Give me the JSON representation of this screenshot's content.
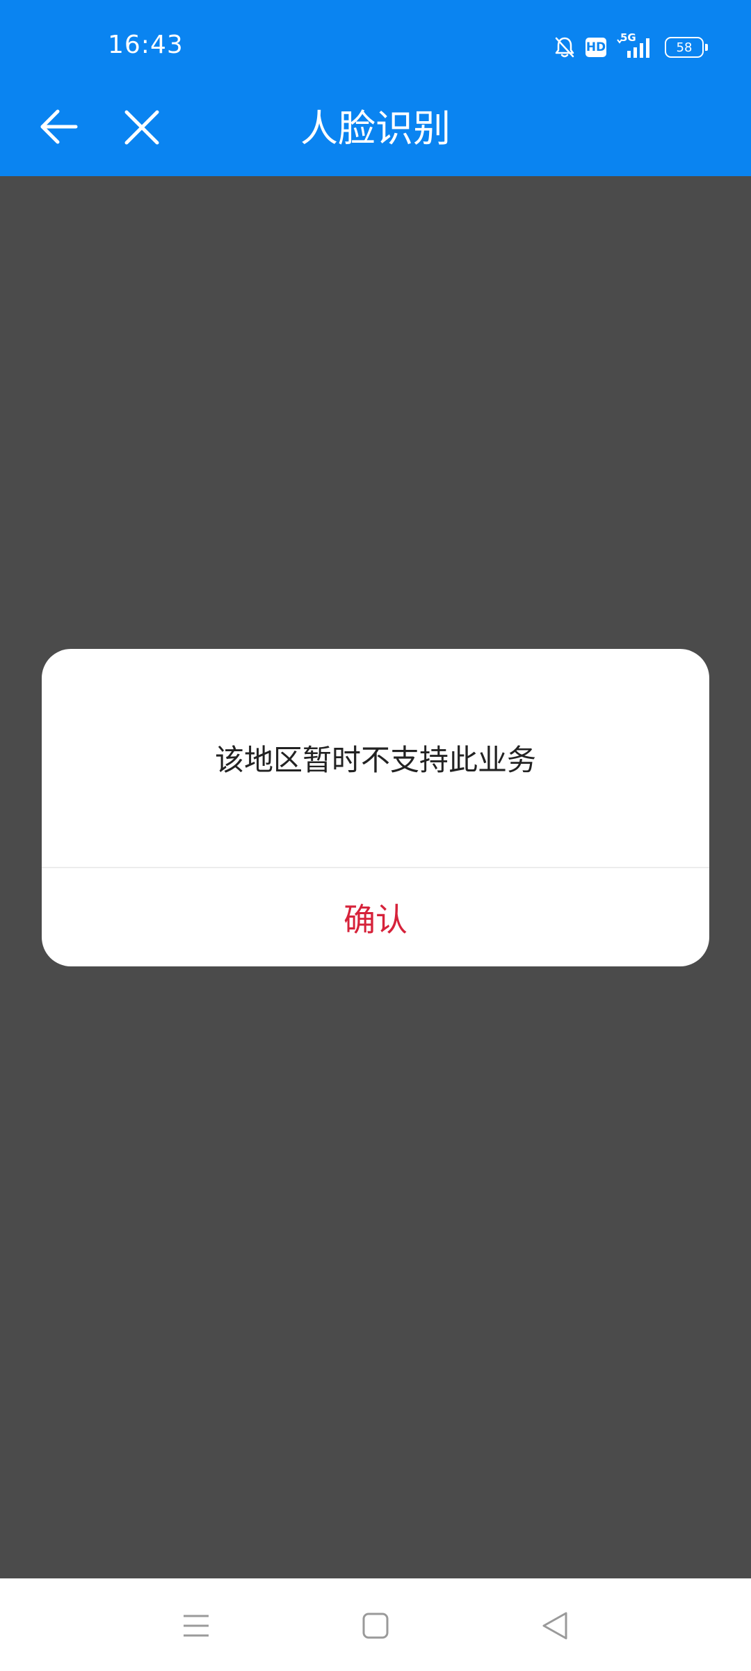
{
  "status_bar": {
    "time": "16:43",
    "hd_label": "HD",
    "network_label": "5G",
    "battery_level": "58",
    "icons": [
      "bell-off-icon",
      "hd-icon",
      "5g-signal-icon",
      "battery-icon"
    ]
  },
  "header": {
    "title": "人脸识别",
    "back_icon": "arrow-left-icon",
    "close_icon": "close-icon",
    "background_color": "#0a84f1"
  },
  "dialog": {
    "message": "该地区暂时不支持此业务",
    "confirm_label": "确认",
    "confirm_color": "#d6223a"
  },
  "system_nav": {
    "icons": [
      "menu-icon",
      "home-icon",
      "back-triangle-icon"
    ]
  },
  "colors": {
    "overlay": "#4b4b4b",
    "dialog_background": "#ffffff"
  }
}
